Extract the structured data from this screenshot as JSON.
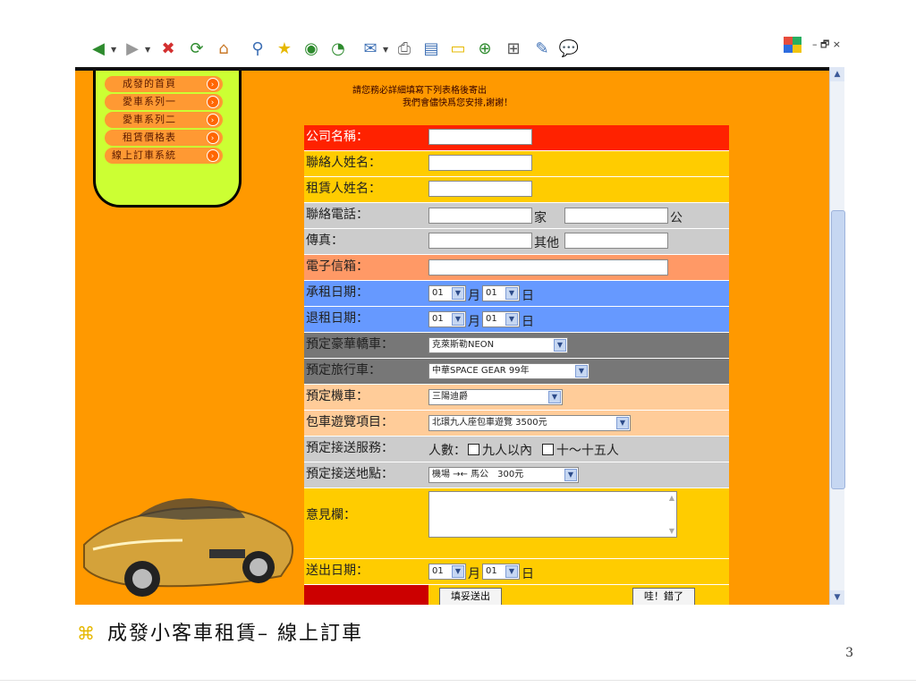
{
  "window_controls": "– 🗗 ×",
  "menu": {
    "items": [
      "成發的首頁",
      "愛車系列一",
      "愛車系列二",
      "租賃價格表",
      "線上訂車系統"
    ]
  },
  "notice": {
    "line1": "請您務必詳細填寫下列表格後寄出",
    "line2": "我們會儘快爲您安排,謝謝！"
  },
  "form": {
    "company_label": "公司名稱：",
    "contact_label": "聯絡人姓名：",
    "renter_label": "租賃人姓名：",
    "phone_label": "聯絡電話：",
    "phone_home_suffix": "家",
    "phone_office_suffix": "公",
    "fax_label": "傳真：",
    "fax_other_suffix": "其他",
    "email_label": "電子信箱：",
    "start_label": "承租日期：",
    "return_label": "退租日期：",
    "luxury_label": "預定豪華轎車：",
    "travel_label": "預定旅行車：",
    "moto_label": "預定機車：",
    "tour_label": "包車遊覽項目：",
    "pickup_label": "預定接送服務：",
    "place_label": "預定接送地點：",
    "comment_label": "意見欄：",
    "submit_date_label": "送出日期：",
    "month_unit": "月",
    "day_unit": "日",
    "start_month": "01",
    "start_day": "01",
    "return_month": "01",
    "return_day": "01",
    "submit_month": "01",
    "submit_day": "01",
    "luxury_value": "克萊斯勒NEON",
    "travel_value": "中華SPACE GEAR 99年",
    "moto_value": "三陽迪爵",
    "tour_value": "北環九人座包車遊覽 3500元",
    "place_value": "機場 →← 馬公　300元",
    "pickup_people": "人數：",
    "pickup_opt1": "九人以內",
    "pickup_opt2": "十～十五人",
    "submit_button": "填妥送出",
    "reset_button": "哇！錯了"
  },
  "caption": {
    "bullet": "⌘",
    "text": "成發小客車租賃– 線上訂車"
  },
  "page_number": "3",
  "colors": {
    "page_bg": "#ff9900",
    "row_red": "#ff2200",
    "row_yellow": "#ffcc00",
    "row_gray": "#cccccc",
    "row_salmon": "#ff9966",
    "row_blue": "#6699ff",
    "row_darkgray": "#777777",
    "row_peach": "#ffcc99",
    "row_darkred": "#cc0000",
    "menu_green": "#ccff33"
  }
}
